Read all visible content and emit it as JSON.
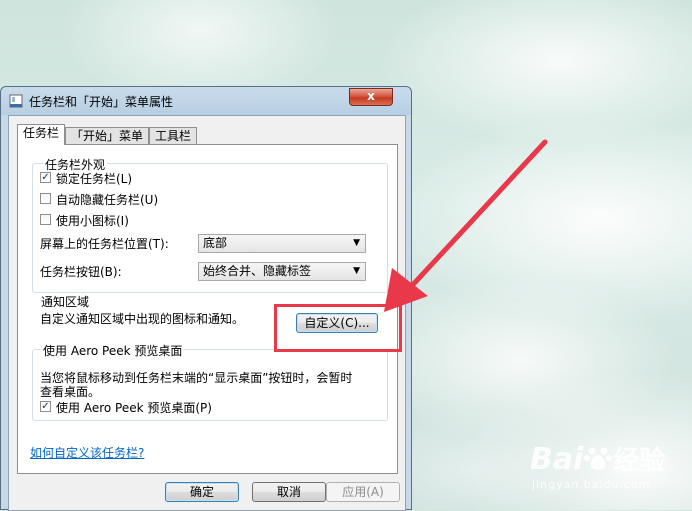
{
  "window": {
    "title": "任务栏和「开始」菜单属性",
    "close_label": "x"
  },
  "tabs": [
    "任务栏",
    "「开始」菜单",
    "工具栏"
  ],
  "appearance": {
    "group_title": "任务栏外观",
    "lock_label": "锁定任务栏(L)",
    "lock_checked": true,
    "autohide_label": "自动隐藏任务栏(U)",
    "autohide_checked": false,
    "small_icons_label": "使用小图标(I)",
    "small_icons_checked": false,
    "location_label": "屏幕上的任务栏位置(T):",
    "location_value": "底部",
    "buttons_label": "任务栏按钮(B):",
    "buttons_value": "始终合并、隐藏标签"
  },
  "notification": {
    "group_title": "通知区域",
    "description": "自定义通知区域中出现的图标和通知。",
    "customize_button": "自定义(C)..."
  },
  "aero_peek": {
    "group_title": "使用 Aero Peek 预览桌面",
    "description_line1": "当您将鼠标移动到任务栏末端的“显示桌面”按钮时，会暂时",
    "description_line2": "查看桌面。",
    "checkbox_label": "使用 Aero Peek 预览桌面(P)",
    "checkbox_checked": true
  },
  "help_link": "如何自定义该任务栏?",
  "buttons": {
    "ok": "确定",
    "cancel": "取消",
    "apply": "应用(A)"
  },
  "watermark": {
    "brand": "Bai",
    "brand_cn": "经验",
    "url": "jingyan.baidu.com"
  },
  "colors": {
    "annotation_red": "#e8384a",
    "link_blue": "#0066cc"
  }
}
